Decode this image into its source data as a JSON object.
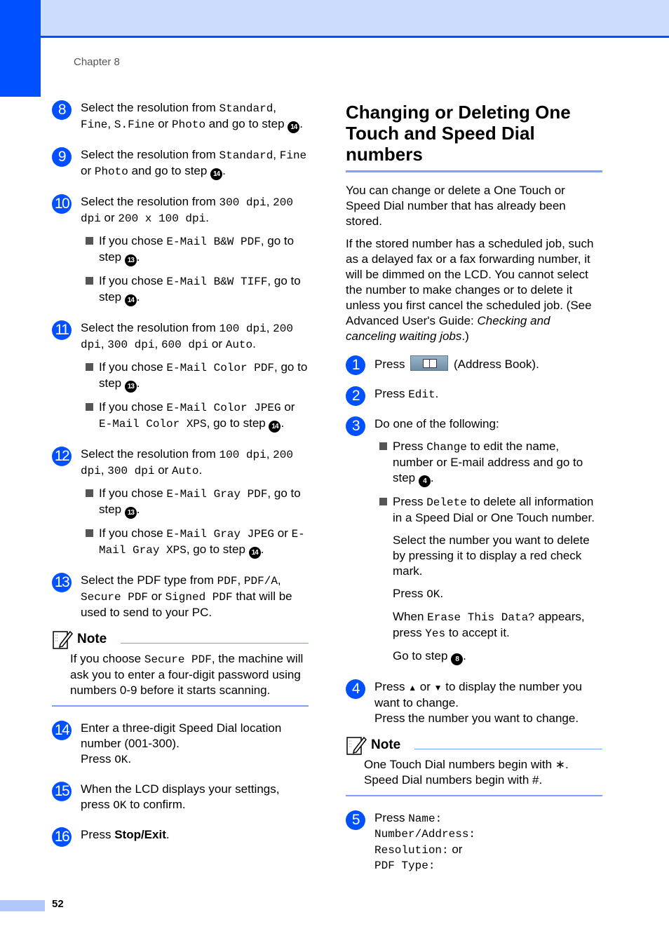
{
  "header": {
    "chapter": "Chapter 8"
  },
  "footer": {
    "page_number": "52"
  },
  "colors": {
    "accent": "#0050ff",
    "band": "#ccdcfc",
    "rule": "#7ba1f5"
  },
  "left": {
    "steps": [
      {
        "num": "8",
        "parts": [
          "Select the resolution from ",
          "Standard",
          ", ",
          "Fine",
          ", ",
          "S.Fine",
          " or ",
          "Photo",
          " and go to step ",
          "14",
          "."
        ]
      },
      {
        "num": "9",
        "parts": [
          "Select the resolution from ",
          "Standard",
          ", ",
          "Fine",
          " or ",
          "Photo",
          " and go to step ",
          "14",
          "."
        ]
      },
      {
        "num": "10",
        "parts": [
          "Select the resolution from ",
          "300 dpi",
          ", ",
          "200 dpi",
          " or ",
          "200 x 100 dpi",
          "."
        ],
        "subs": [
          [
            "If you chose ",
            "E-Mail B&W PDF",
            ", go to step ",
            "13",
            "."
          ],
          [
            "If you chose ",
            "E-Mail B&W TIFF",
            ", go to step ",
            "14",
            "."
          ]
        ]
      },
      {
        "num": "11",
        "parts": [
          "Select the resolution from ",
          "100 dpi",
          ", ",
          "200 dpi",
          ", ",
          "300 dpi",
          ", ",
          "600 dpi",
          " or ",
          "Auto",
          "."
        ],
        "subs": [
          [
            "If you chose ",
            "E-Mail Color PDF",
            ", go to step ",
            "13",
            "."
          ],
          [
            "If you chose ",
            "E-Mail Color JPEG",
            " or ",
            "E-Mail Color XPS",
            ", go to step ",
            "14",
            "."
          ]
        ]
      },
      {
        "num": "12",
        "parts": [
          "Select the resolution from ",
          "100 dpi",
          ", ",
          "200 dpi",
          ", ",
          "300 dpi",
          " or ",
          "Auto",
          "."
        ],
        "subs": [
          [
            "If you chose ",
            "E-Mail Gray PDF",
            ", go to step ",
            "13",
            "."
          ],
          [
            "If you chose ",
            "E-Mail Gray JPEG",
            " or ",
            "E-Mail Gray XPS",
            ", go to step ",
            "14",
            "."
          ]
        ]
      },
      {
        "num": "13",
        "parts": [
          "Select the PDF type from ",
          "PDF",
          ", ",
          "PDF/A",
          ", ",
          "Secure PDF",
          " or ",
          "Signed PDF",
          " that will be used to send to your PC."
        ]
      }
    ],
    "note": {
      "label": "Note",
      "parts": [
        "If you choose ",
        "Secure PDF",
        ", the machine will ask you to enter a four-digit password using numbers 0-9 before it starts scanning."
      ]
    },
    "steps2": [
      {
        "num": "14",
        "line1": "Enter a three-digit Speed Dial location number (001-300).",
        "line2a": "Press ",
        "line2b": "OK",
        "line2c": "."
      },
      {
        "num": "15",
        "a": "When the LCD displays your settings, press ",
        "b": "OK",
        "c": " to confirm."
      },
      {
        "num": "16",
        "a": "Press ",
        "b": "Stop/Exit",
        "c": "."
      }
    ]
  },
  "right": {
    "title": "Changing or Deleting One Touch and Speed Dial numbers",
    "intro": "You can change or delete a One Touch or Speed Dial number that has already been stored.",
    "para2": "If the stored number has a scheduled job, such as a delayed fax or a fax forwarding number, it will be dimmed on the LCD. You cannot select the number to make changes or to delete it unless you first cancel the scheduled job. (See Advanced User's Guide: ",
    "para2_italic": "Checking and canceling waiting jobs",
    "para2_end": ".)",
    "step1": {
      "num": "1",
      "a": "Press",
      "icon": "address-book-button-icon",
      "b": "(Address Book)."
    },
    "step2": {
      "num": "2",
      "a": "Press ",
      "b": "Edit",
      "c": "."
    },
    "step3": {
      "num": "3",
      "text": "Do one of the following:",
      "sub1": {
        "a": "Press ",
        "b": "Change",
        "c": " to edit the name, number or E-mail address and go to step ",
        "ref": "4",
        "d": "."
      },
      "sub2": {
        "a": "Press ",
        "b": "Delete",
        "c": " to delete all information in a Speed Dial or One Touch number."
      },
      "p1": "Select the number you want to delete by pressing it to display a red check mark.",
      "p2": {
        "a": "Press ",
        "b": "OK",
        "c": "."
      },
      "p3": {
        "a": "When ",
        "b": "Erase This Data?",
        "c": " appears, press ",
        "d": "Yes",
        "e": " to accept it."
      },
      "p4": {
        "a": "Go to step ",
        "ref": "8",
        "c": "."
      }
    },
    "step4": {
      "num": "4",
      "a": "Press ",
      "up": "▲",
      "b": " or ",
      "down": "▼",
      "c": " to display the number you want to change.",
      "d": "Press the number you want to change."
    },
    "note": {
      "label": "Note",
      "line1": "One Touch Dial numbers begin with ∗.",
      "line2": "Speed Dial numbers begin with #."
    },
    "step5": {
      "num": "5",
      "a": "Press ",
      "o1": "Name:",
      "o2": "Number/Address:",
      "o3": "Resolution:",
      "or": " or",
      "o4": "PDF Type:"
    }
  }
}
